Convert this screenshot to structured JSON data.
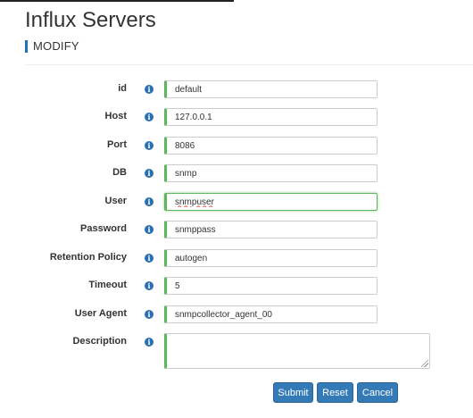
{
  "header": {
    "title": "Influx Servers",
    "subtitle": "MODIFY"
  },
  "form": {
    "info_icon": "info-circle-icon",
    "fields": {
      "id": {
        "label": "id",
        "value": "default"
      },
      "host": {
        "label": "Host",
        "value": "127.0.0.1"
      },
      "port": {
        "label": "Port",
        "value": "8086"
      },
      "db": {
        "label": "DB",
        "value": "snmp"
      },
      "user": {
        "label": "User",
        "value": "snmpuser"
      },
      "password": {
        "label": "Password",
        "value": "snmppass"
      },
      "retention_policy": {
        "label": "Retention Policy",
        "value": "autogen"
      },
      "timeout": {
        "label": "Timeout",
        "value": "5"
      },
      "user_agent": {
        "label": "User Agent",
        "value": "snmpcollector_agent_00"
      },
      "description": {
        "label": "Description",
        "value": ""
      }
    },
    "buttons": {
      "submit": "Submit",
      "reset": "Reset",
      "cancel": "Cancel"
    }
  },
  "colors": {
    "accent": "#1a75b6",
    "valid": "#5cb85c",
    "button": "#337ab7"
  }
}
